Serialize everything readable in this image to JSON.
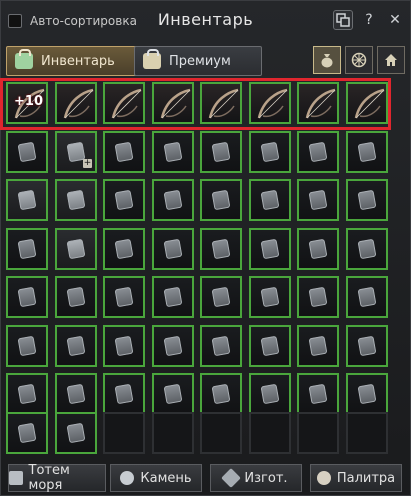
{
  "header": {
    "autosort_label": "Авто-сортировка",
    "title": "Инвентарь",
    "icons": [
      "window-mode-icon",
      "help-icon",
      "close-icon"
    ],
    "help_glyph": "?",
    "close_glyph": "✕"
  },
  "tabs": [
    {
      "label": "Инвентарь",
      "active": true
    },
    {
      "label": "Премиум",
      "active": false
    }
  ],
  "right_tab_icons": [
    "money-bag-icon",
    "gear-wheel-icon",
    "house-icon"
  ],
  "grid": {
    "highlighted_row_badge": "+10",
    "bow_row_count": 8,
    "rows": 7,
    "cols": 8,
    "filled_in_last_row": 2
  },
  "bottom_buttons": [
    {
      "label": "Тотем моря",
      "icon": "totem-icon"
    },
    {
      "label": "Камень",
      "icon": "stone-swirl-icon"
    },
    {
      "label": "Изгот.",
      "icon": "craft-hammer-icon"
    },
    {
      "label": "Палитра",
      "icon": "palette-icon"
    }
  ],
  "colors": {
    "slot_border": "#4aa63c",
    "highlight": "#e0262e",
    "active_tab": "#c0a26a"
  }
}
